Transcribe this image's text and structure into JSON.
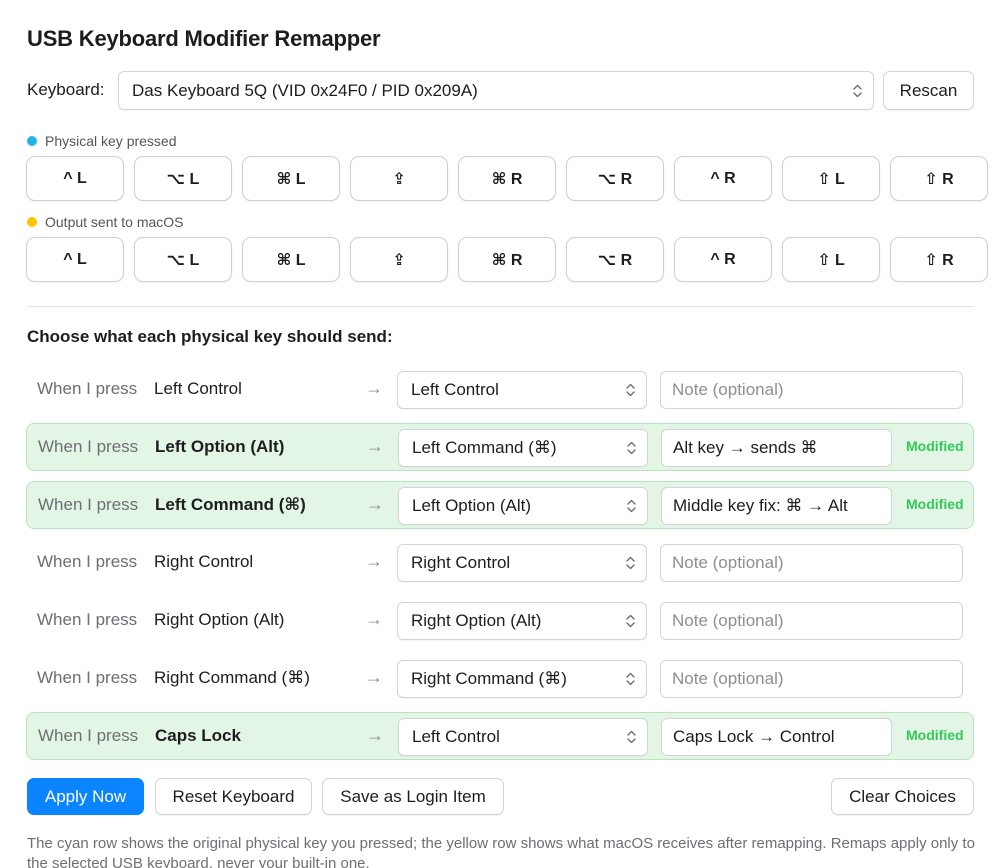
{
  "title": "USB Keyboard Modifier Remapper",
  "keyboard": {
    "label": "Keyboard:",
    "selected": "Das Keyboard 5Q  (VID 0x24F0 / PID 0x209A)",
    "rescan_label": "Rescan"
  },
  "legend": {
    "physical": {
      "label": "Physical key pressed",
      "color": "#1fb5e6"
    },
    "output": {
      "label": "Output sent to macOS",
      "color": "#ffc400"
    }
  },
  "physical_keys": [
    "^ L",
    "⌥ L",
    "⌘ L",
    "⇪",
    "⌘ R",
    "⌥ R",
    "^ R",
    "⇧ L",
    "⇧ R"
  ],
  "output_keys": [
    "^ L",
    "⌥ L",
    "⌘ L",
    "⇪",
    "⌘ R",
    "⌥ R",
    "^ R",
    "⇧ L",
    "⇧ R"
  ],
  "section_title": "Choose what each physical key should send:",
  "when_prefix": "When I press",
  "arrow": "→",
  "note_placeholder": "Note (optional)",
  "modified_label": "Modified",
  "mappings": [
    {
      "source": "Left Control",
      "dest": "Left Control",
      "note": "",
      "modified": false
    },
    {
      "source": "Left Option (Alt)",
      "dest": "Left Command (⌘)",
      "note": "Alt key → sends ⌘",
      "modified": true
    },
    {
      "source": "Left Command (⌘)",
      "dest": "Left Option (Alt)",
      "note": "Middle key fix: ⌘ → Alt",
      "modified": true
    },
    {
      "source": "Right Control",
      "dest": "Right Control",
      "note": "",
      "modified": false
    },
    {
      "source": "Right Option (Alt)",
      "dest": "Right Option (Alt)",
      "note": "",
      "modified": false
    },
    {
      "source": "Right Command (⌘)",
      "dest": "Right Command (⌘)",
      "note": "",
      "modified": false
    },
    {
      "source": "Caps Lock",
      "dest": "Left Control",
      "note": "Caps Lock → Control",
      "modified": true
    }
  ],
  "actions": {
    "apply": "Apply Now",
    "reset": "Reset Keyboard",
    "login": "Save as Login Item",
    "clear": "Clear Choices"
  },
  "footnote": "The cyan row shows the original physical key you pressed; the yellow row shows what macOS receives after remapping. Remaps apply only to the selected USB keyboard, never your built-in one.",
  "colors": {
    "accent": "#0a84ff",
    "modified_bg": "#e3f6e6",
    "modified_text": "#34c759"
  }
}
